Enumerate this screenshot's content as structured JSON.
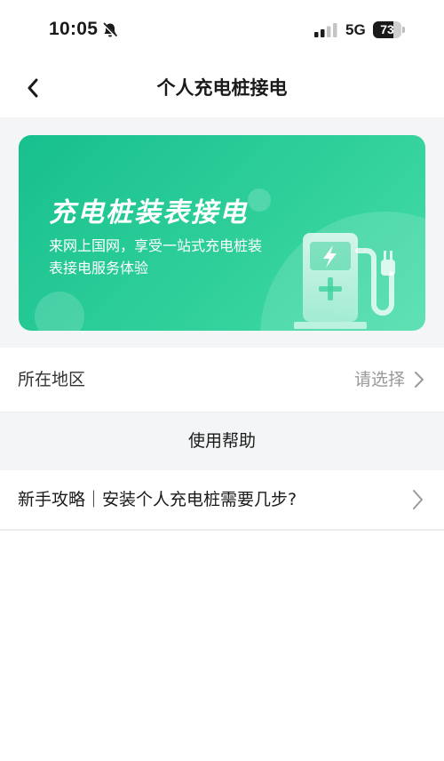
{
  "status_bar": {
    "time": "10:05",
    "network": "5G",
    "battery": "73",
    "battery_level": 0.73
  },
  "nav": {
    "title": "个人充电桩接电"
  },
  "banner": {
    "title": "充电桩装表接电",
    "subtitle": "来网上国网，享受一站式充电桩装表接电服务体验"
  },
  "region": {
    "label": "所在地区",
    "placeholder": "请选择"
  },
  "help": {
    "title": "使用帮助",
    "items": [
      {
        "label": "新手攻略｜安装个人充电桩需要几步?"
      }
    ]
  },
  "colors": {
    "banner_start": "#17c08e",
    "banner_end": "#45dca8",
    "page_grey": "#f4f5f7"
  }
}
